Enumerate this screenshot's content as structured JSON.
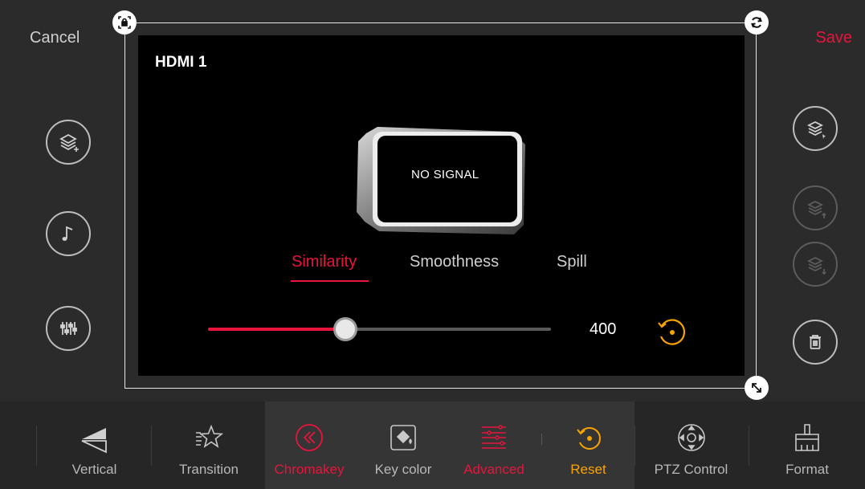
{
  "header": {
    "cancel_label": "Cancel",
    "save_label": "Save"
  },
  "preview": {
    "source_name": "HDMI 1",
    "status_text": "NO SIGNAL"
  },
  "chromakey_tabs": [
    "Similarity",
    "Smoothness",
    "Spill"
  ],
  "active_tab": "Similarity",
  "slider": {
    "value": "400",
    "fill_fraction": 0.4
  },
  "left_tools": [
    "add-layer-icon",
    "music-note-icon",
    "audio-mixer-icon"
  ],
  "right_tools": [
    "select-layer-icon",
    "layer-up-icon",
    "layer-down-icon",
    "trash-icon"
  ],
  "toolbar": {
    "vertical": "Vertical",
    "transition": "Transition",
    "chromakey": "Chromakey",
    "key_color": "Key color",
    "advanced": "Advanced",
    "reset": "Reset",
    "ptz": "PTZ Control",
    "format": "Format"
  },
  "colors": {
    "accent_red": "#e8143c",
    "accent_orange": "#f8a400"
  }
}
